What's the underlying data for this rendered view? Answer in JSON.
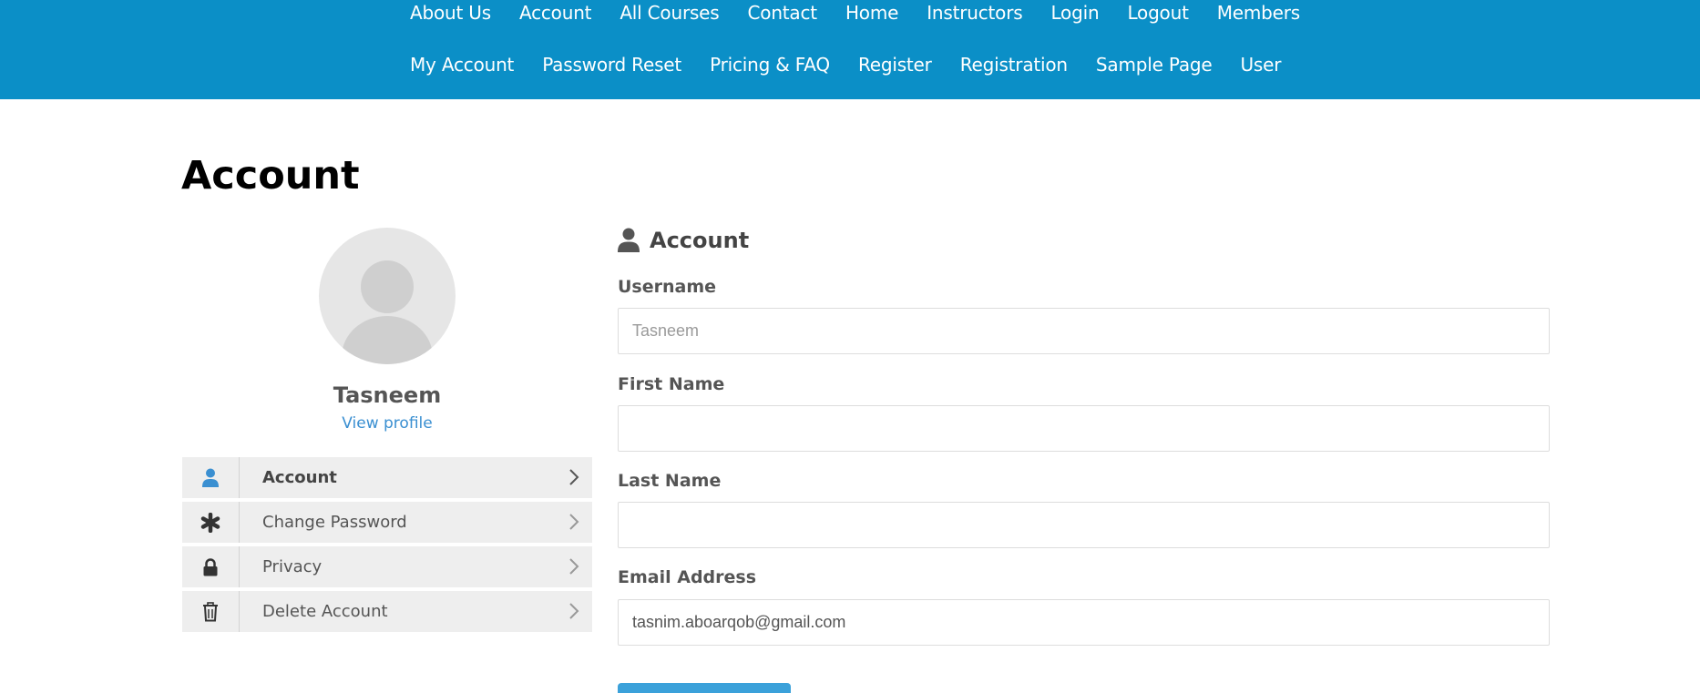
{
  "nav": {
    "row1": [
      "About Us",
      "Account",
      "All Courses",
      "Contact",
      "Home",
      "Instructors",
      "Login",
      "Logout",
      "Members"
    ],
    "row2": [
      "My Account",
      "Password Reset",
      "Pricing & FAQ",
      "Register",
      "Registration",
      "Sample Page",
      "User"
    ]
  },
  "page": {
    "title": "Account"
  },
  "profile": {
    "name": "Tasneem",
    "view_profile": "View profile"
  },
  "side_menu": [
    {
      "label": "Account",
      "icon": "user-icon",
      "active": true
    },
    {
      "label": "Change Password",
      "icon": "asterisk-icon",
      "active": false
    },
    {
      "label": "Privacy",
      "icon": "lock-icon",
      "active": false
    },
    {
      "label": "Delete Account",
      "icon": "trash-icon",
      "active": false
    }
  ],
  "form": {
    "heading": "Account",
    "username": {
      "label": "Username",
      "placeholder": "Tasneem"
    },
    "first_name": {
      "label": "First Name",
      "value": ""
    },
    "last_name": {
      "label": "Last Name",
      "value": ""
    },
    "email": {
      "label": "Email Address",
      "value": "tasnim.aboarqob@gmail.com"
    }
  },
  "colors": {
    "nav_bg": "#0b8fc7",
    "accent": "#3a8fd1",
    "menu_bg": "#eeeeee"
  }
}
